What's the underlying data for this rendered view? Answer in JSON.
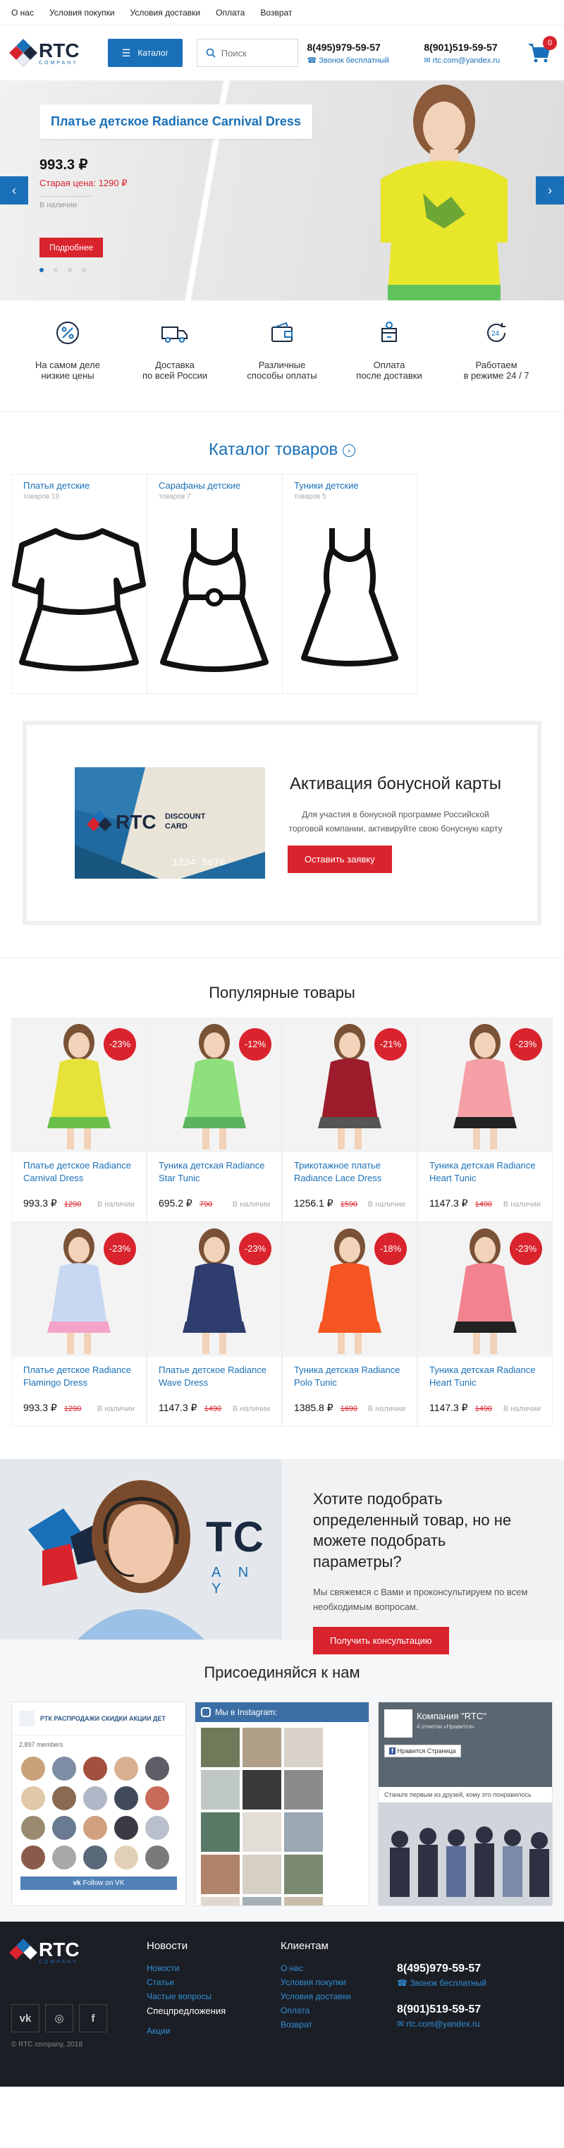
{
  "topnav": [
    "О нас",
    "Условия покупки",
    "Условия доставки",
    "Оплата",
    "Возврат"
  ],
  "logo": {
    "text": "RTC",
    "sub": "COMPANY"
  },
  "header": {
    "catalog_label": "Каталог",
    "search_placeholder": "Поиск",
    "phone1": "8(495)979-59-57",
    "phone1_sub": "Звонок бесплатный",
    "phone2": "8(901)519-59-57",
    "email": "rtc.com@yandex.ru",
    "cart_count": "0"
  },
  "slider": {
    "title": "Платье детское Radiance Carnival Dress",
    "price": "993.3 ₽",
    "old_price": "Старая цена: 1290 ₽",
    "availability": "В наличии",
    "more_label": "Подробнее",
    "prev": "‹",
    "next": "›"
  },
  "features": [
    {
      "icon": "percent-icon",
      "l1": "На самом деле",
      "l2": "низкие цены"
    },
    {
      "icon": "truck-icon",
      "l1": "Доставка",
      "l2": "по всей России"
    },
    {
      "icon": "wallet-icon",
      "l1": "Различные",
      "l2": "способы оплаты"
    },
    {
      "icon": "box-delivery-icon",
      "l1": "Оплата",
      "l2": "после доставки"
    },
    {
      "icon": "clock-24-icon",
      "l1": "Работаем",
      "l2": "в режиме 24 / 7"
    }
  ],
  "catalog": {
    "title": "Каталог товаров",
    "items": [
      {
        "name": "Платья детские",
        "count": "товаров 18"
      },
      {
        "name": "Сарафаны детские",
        "count": "товаров 7"
      },
      {
        "name": "Туники детские",
        "count": "товаров 5"
      }
    ]
  },
  "bonus": {
    "title": "Активация бонусной карты",
    "text": "Для участия в бонусной программе Российской торговой компании, активируйте свою бонусную карту",
    "button": "Оставить заявку",
    "card_brand": "RTC",
    "card_label1": "DISCOUNT",
    "card_label2": "CARD",
    "card_number": "1234 5678"
  },
  "popular": {
    "title": "Популярные товары",
    "items": [
      {
        "name": "Платье детское Radiance Carnival Dress",
        "price": "993.3 ₽",
        "old": "1290",
        "disc": "-23%",
        "avail": "В наличии",
        "dress": "#e6e23a",
        "accent": "#6bc04b"
      },
      {
        "name": "Туника детская Radiance Star Tunic",
        "price": "695.2 ₽",
        "old": "790",
        "disc": "-12%",
        "avail": "В наличии",
        "dress": "#8ee07c",
        "accent": "#5bb35f"
      },
      {
        "name": "Трикотажное платье Radiance Lace Dress",
        "price": "1256.1 ₽",
        "old": "1590",
        "disc": "-21%",
        "avail": "В наличии",
        "dress": "#9c1c2c",
        "accent": "#555555"
      },
      {
        "name": "Туника детская Radiance Heart Tunic",
        "price": "1147.3 ₽",
        "old": "1490",
        "disc": "-23%",
        "avail": "В наличии",
        "dress": "#f4a0a6",
        "accent": "#222222"
      },
      {
        "name": "Платье детское Radiance Flamingo Dress",
        "price": "993.3 ₽",
        "old": "1290",
        "disc": "-23%",
        "avail": "В наличии",
        "dress": "#c9d8f2",
        "accent": "#f3a3c8"
      },
      {
        "name": "Платье детское Radiance Wave Dress",
        "price": "1147.3 ₽",
        "old": "1490",
        "disc": "-23%",
        "avail": "В наличии",
        "dress": "#2e3c6e",
        "accent": "#2e3c6e"
      },
      {
        "name": "Туника детская Radiance Polo Tunic",
        "price": "1385.8 ₽",
        "old": "1690",
        "disc": "-18%",
        "avail": "В наличии",
        "dress": "#f45522",
        "accent": "#f45522"
      },
      {
        "name": "Туника детская Radiance Heart Tunic",
        "price": "1147.3 ₽",
        "old": "1490",
        "disc": "-23%",
        "avail": "В наличии",
        "dress": "#f2828f",
        "accent": "#222222"
      }
    ]
  },
  "consult": {
    "brand_fragment": "TC",
    "brand_sub": "A N Y",
    "title": "Хотите подобрать определенный товар, но не можете подобрать параметры?",
    "text": "Мы свяжемся с Вами и проконсультируем по всем необходимым вопросам.",
    "button": "Получить консультацию"
  },
  "join": {
    "title": "Присоединяйся к нам",
    "vk": {
      "group": "РТК РАСПРОДАЖИ СКИДКИ АКЦИИ ДЕТ",
      "members": "2,897 members",
      "follow": "Follow on VK"
    },
    "instagram": {
      "header": "Мы в Instagram:"
    },
    "facebook": {
      "page": "Компания \"RTC\"",
      "likes": "4 отметки «Нравится»",
      "like_btn": "Нравится Страница",
      "text": "Станьте первым из друзей, кому это понравилось"
    }
  },
  "footer": {
    "copyright": "© RTC company, 2018",
    "col1_title": "Новости",
    "col1": [
      "Новости",
      "Статьи",
      "Частые вопросы"
    ],
    "col1_extra": "Спецпредложения",
    "col1_last": "Акции",
    "col2_title": "Клиентам",
    "col2": [
      "О нас",
      "Условия покупки",
      "Условия доставки",
      "Оплата",
      "Возврат"
    ],
    "phone1": "8(495)979-59-57",
    "phone1_sub": "Звонок бесплатный",
    "phone2": "8(901)519-59-57",
    "email": "rtc.com@yandex.ru"
  },
  "colors": {
    "accent": "#1a70b8",
    "red": "#d9232d",
    "dark": "#1c1e26"
  }
}
